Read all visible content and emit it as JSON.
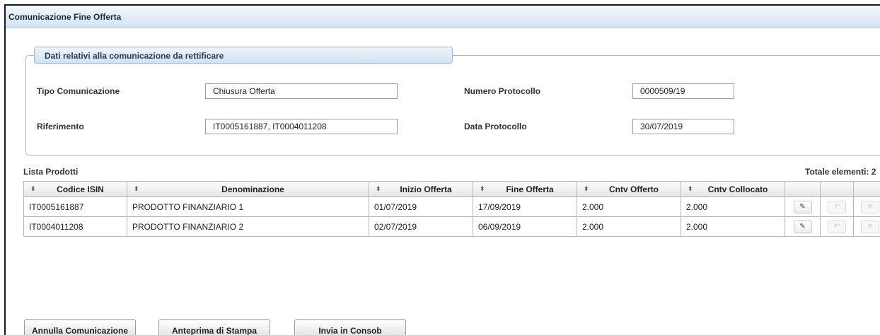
{
  "window": {
    "title": "Comunicazione Fine Offerta"
  },
  "section": {
    "legend": "Dati relativi alla comunicazione da rettificare",
    "tipo_label": "Tipo Comunicazione",
    "tipo_value": "Chiusura Offerta",
    "riferimento_label": "Riferimento",
    "riferimento_value": "IT0005161887, IT0004011208",
    "numero_label": "Numero Protocollo",
    "numero_value": "0000509/19",
    "data_label": "Data Protocollo",
    "data_value": "30/07/2019"
  },
  "list": {
    "title": "Lista Prodotti",
    "totale": "Totale elementi: 2",
    "sort_icon": "⬍",
    "columns": [
      "Codice ISIN",
      "Denominazione",
      "Inizio Offerta",
      "Fine Offerta",
      "Cntv Offerto",
      "Cntv Collocato"
    ],
    "rows": [
      [
        "IT0005161887",
        "PRODOTTO FINANZIARIO 1",
        "01/07/2019",
        "17/09/2019",
        "2.000",
        "2.000"
      ],
      [
        "IT0004011208",
        "PRODOTTO FINANZIARIO 2",
        "02/07/2019",
        "06/09/2019",
        "2.000",
        "2.000"
      ]
    ],
    "row_actions": [
      {
        "icon": "edit-icon",
        "glyph": "✎"
      },
      {
        "icon": "undo-icon",
        "glyph": "↶"
      },
      {
        "icon": "delete-icon",
        "glyph": "✕"
      }
    ]
  },
  "buttons": {
    "annulla": "Annulla Comunicazione",
    "anteprima": "Anteprima di Stampa",
    "invia": "Invia in Consob"
  }
}
